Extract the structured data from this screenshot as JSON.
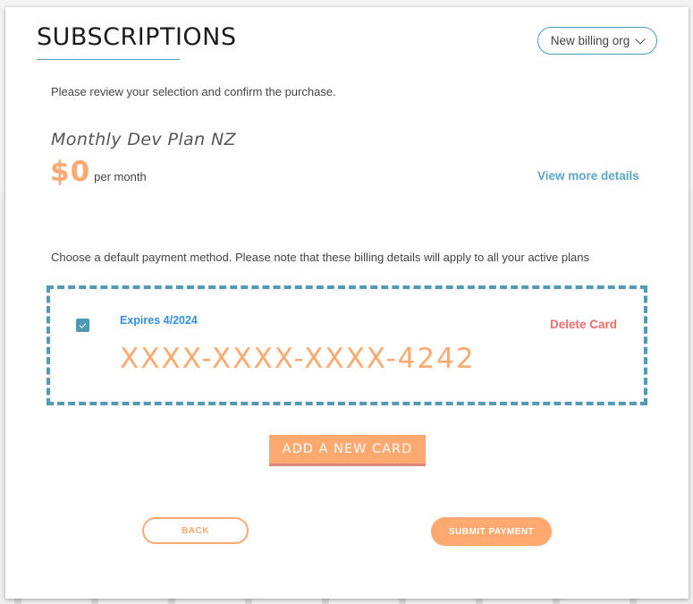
{
  "header": {
    "title": "SUBSCRIPTIONS",
    "org_select": {
      "selected": "New billing org",
      "icon": "chevron-down-icon"
    }
  },
  "review": {
    "instruction": "Please review your selection and confirm the purchase."
  },
  "plan": {
    "name": "Monthly Dev Plan NZ",
    "price": "$0",
    "period": "per month",
    "details_link": "View more details"
  },
  "payment": {
    "instruction": "Choose a default payment method. Please note that these billing details will apply to all your active plans",
    "card": {
      "selected": true,
      "expiry": "Expires 4/2024",
      "number": "XXXX-XXXX-XXXX-4242",
      "delete_label": "Delete Card"
    },
    "add_card_label": "ADD A NEW CARD"
  },
  "actions": {
    "back_label": "BACK",
    "submit_label": "SUBMIT PAYMENT"
  },
  "colors": {
    "accent_orange": "#ffa86f",
    "accent_teal": "#4d9ab6",
    "link_blue": "#5aa6c4",
    "expiry_blue": "#2f8fe6",
    "danger_red": "#ef6d6d"
  }
}
